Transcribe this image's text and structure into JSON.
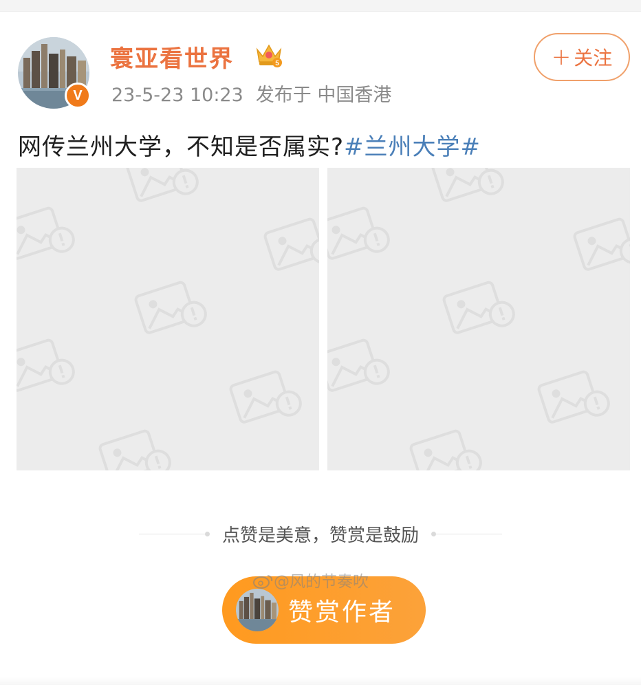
{
  "header": {
    "username": "寰亚看世界",
    "verified_badge": "V",
    "timestamp": "23-5-23 10:23",
    "published_at": "发布于 中国香港",
    "follow_plus": "+",
    "follow_label": "关注"
  },
  "post": {
    "text": "网传兰州大学，不知是否属实?",
    "hashtag": "#兰州大学#"
  },
  "reward": {
    "slogan": "点赞是美意，赞赏是鼓励",
    "button_label": "赞赏作者"
  },
  "watermark": "@风的节奏吹",
  "colors": {
    "username": "#eb7340",
    "hashtag": "#4a7fb8",
    "reward_button": "#ff9a1f",
    "image_placeholder": "#ececec"
  },
  "icons": {
    "crown": "crown-icon",
    "badge": "verified-icon",
    "image_placeholder": "broken-image-icon",
    "watermark": "weibo-icon"
  }
}
